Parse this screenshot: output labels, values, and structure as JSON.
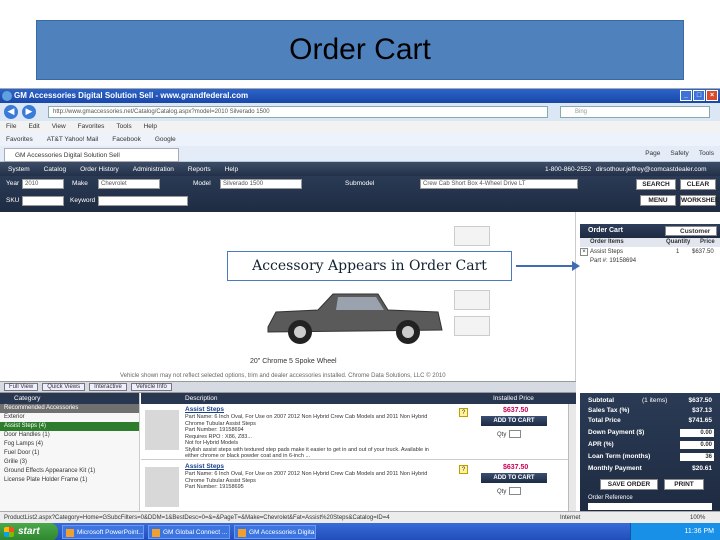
{
  "slide": {
    "title": "Order Cart"
  },
  "callout": {
    "text": "Accessory Appears in Order Cart"
  },
  "browser": {
    "window_title": "GM Accessories Digital Solution Sell - www.grandfederal.com",
    "url": "http://www.gmaccessories.net/Catalog/Catalog.aspx?model=2010 Silverado 1500",
    "search_placeholder": "Bing",
    "menu": [
      "File",
      "Edit",
      "View",
      "Favorites",
      "Tools",
      "Help"
    ],
    "favorites": [
      "Favorites",
      "AT&T Yahoo! Mail",
      "Facebook",
      "Google"
    ],
    "tab_label": "GM Accessories Digital Solution Sell",
    "tab_tools": [
      "Page",
      "Safety",
      "Tools"
    ]
  },
  "app": {
    "nav": [
      "System",
      "Catalog",
      "Order History",
      "Administration",
      "Reports",
      "Help"
    ],
    "phone": "1-800-860-2552",
    "email": "dirsothour.jeffrey@comcastdealer.com",
    "filters": {
      "year_label": "Year",
      "year_value": "2010",
      "make_label": "Make",
      "make_value": "Chevrolet",
      "model_label": "Model",
      "model_value": "Silverado 1500",
      "submodel_label": "Submodel",
      "submodel_value": "Crew Cab Short Box 4-Wheel Drive LT",
      "sku_label": "SKU",
      "keyword_label": "Keyword",
      "search_btn": "SEARCH",
      "clear_btn": "CLEAR",
      "menu_btn": "MENU",
      "worksheet_btn": "WORKSHEET"
    },
    "hero": {
      "caption": "20\" Chrome 5 Spoke Wheel",
      "disclaimer": "Vehicle shown may not reflect selected options, trim and dealer accessories installed. Chrome Data Solutions, LLC © 2010"
    },
    "view_tabs": [
      "Full View",
      "Quick Views",
      "Interactive",
      "Vehicle Info"
    ]
  },
  "cart": {
    "header": "Order Cart",
    "customer_btn": "Customer",
    "columns": [
      "Order Items",
      "Quantity",
      "Price"
    ],
    "items": [
      {
        "name": "Assist Steps",
        "qty": "1",
        "price": "$637.50"
      },
      {
        "name": "Part #: 19158694",
        "qty": "",
        "price": ""
      }
    ]
  },
  "categories": {
    "header": "Category",
    "items": [
      {
        "label": "Recommended Accessories",
        "state": "grey"
      },
      {
        "label": "Exterior",
        "state": "normal"
      },
      {
        "label": "Assist Steps (4)",
        "state": "sel"
      },
      {
        "label": "Door Handles (1)",
        "state": "normal"
      },
      {
        "label": "Fog Lamps (4)",
        "state": "normal"
      },
      {
        "label": "Fuel Door (1)",
        "state": "normal"
      },
      {
        "label": "Grille (3)",
        "state": "normal"
      },
      {
        "label": "Ground Effects Appearance Kit (1)",
        "state": "normal"
      },
      {
        "label": "License Plate Holder Frame (1)",
        "state": "normal"
      }
    ]
  },
  "products": {
    "header_desc": "Description",
    "header_price": "Installed Price",
    "items": [
      {
        "title": "Assist Steps",
        "desc": "Part Name: 6 Inch Oval, For Use on 2007 2012 Non Hybrid Crew Cab Models and 2011 Non Hybrid\nChrome Tubular Assist Steps\nPart Number: 19158694\nRequires RPO : X86, Z83...\nNot for Hybrid Models\nStylish assist steps with textured step pads make it easier to get in and out of your truck. Available in\neither chrome or black powder coat and in 6-inch ...",
        "price": "$637.50",
        "add_btn": "ADD TO CART",
        "qty_label": "Qty"
      },
      {
        "title": "Assist Steps",
        "desc": "Part Name: 6 Inch Oval, For Use on 2007 2012 Non Hybrid Crew Cab Models and 2011 Non Hybrid\nChrome Tubular Assist Steps\nPart Number: 19158695",
        "price": "$637.50",
        "add_btn": "ADD TO CART",
        "qty_label": "Qty"
      }
    ]
  },
  "summary": {
    "rows": [
      {
        "label": "Subtotal",
        "extra": "(1 items)",
        "value": "$637.50",
        "box": false
      },
      {
        "label": "Sales Tax (%)",
        "extra": "",
        "value": "$37.13",
        "box": false
      },
      {
        "label": "Total Price",
        "extra": "",
        "value": "$741.65",
        "box": false
      },
      {
        "label": "Down Payment ($)",
        "extra": "",
        "value": "0.00",
        "box": true
      },
      {
        "label": "APR (%)",
        "extra": "",
        "value": "0.00",
        "box": true
      },
      {
        "label": "Loan Term (months)",
        "extra": "",
        "value": "36",
        "box": true
      },
      {
        "label": "Monthly Payment",
        "extra": "",
        "value": "$20.61",
        "box": false
      }
    ],
    "save_btn": "SAVE ORDER",
    "print_btn": "PRINT",
    "order_ref": "Order Reference"
  },
  "status": {
    "text": "ProductList2.aspx?Category=Home=GSubcFilters=0&DDM=1&BestDesc=0=&=&PageT=&Make=Chevrolet&Fat=Assist%20Steps&Catalog=ID=4",
    "zone": "Internet",
    "zoom": "100%"
  },
  "taskbar": {
    "start": "start",
    "items": [
      "Microsoft PowerPoint...",
      "GM Global Connect ...",
      "GM Accessories Digita..."
    ],
    "clock": "11:36 PM"
  }
}
